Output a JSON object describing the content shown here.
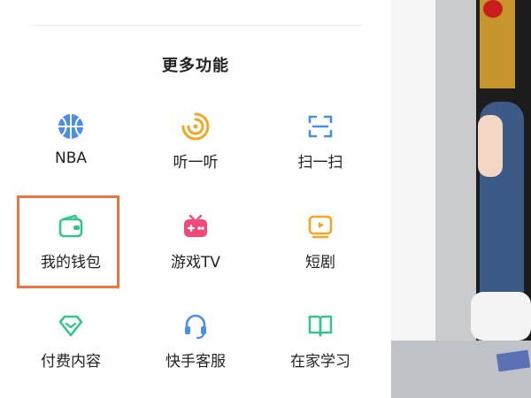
{
  "section": {
    "title": "更多功能"
  },
  "features": [
    {
      "label": "NBA",
      "icon": "basketball-icon",
      "color": "#4a8fe7"
    },
    {
      "label": "听一听",
      "icon": "audio-wave-icon",
      "color": "#f5a623"
    },
    {
      "label": "扫一扫",
      "icon": "scan-icon",
      "color": "#4a8fe7"
    },
    {
      "label": "我的钱包",
      "icon": "wallet-icon",
      "color": "#33c58e"
    },
    {
      "label": "游戏TV",
      "icon": "game-tv-icon",
      "color": "#ef4b7a"
    },
    {
      "label": "短剧",
      "icon": "short-video-icon",
      "color": "#f5a623"
    },
    {
      "label": "付费内容",
      "icon": "diamond-icon",
      "color": "#33c58e"
    },
    {
      "label": "快手客服",
      "icon": "headset-icon",
      "color": "#4a8fe7"
    },
    {
      "label": "在家学习",
      "icon": "book-icon",
      "color": "#33c58e"
    }
  ],
  "highlight": {
    "target": "我的钱包",
    "color": "#f0733f"
  }
}
